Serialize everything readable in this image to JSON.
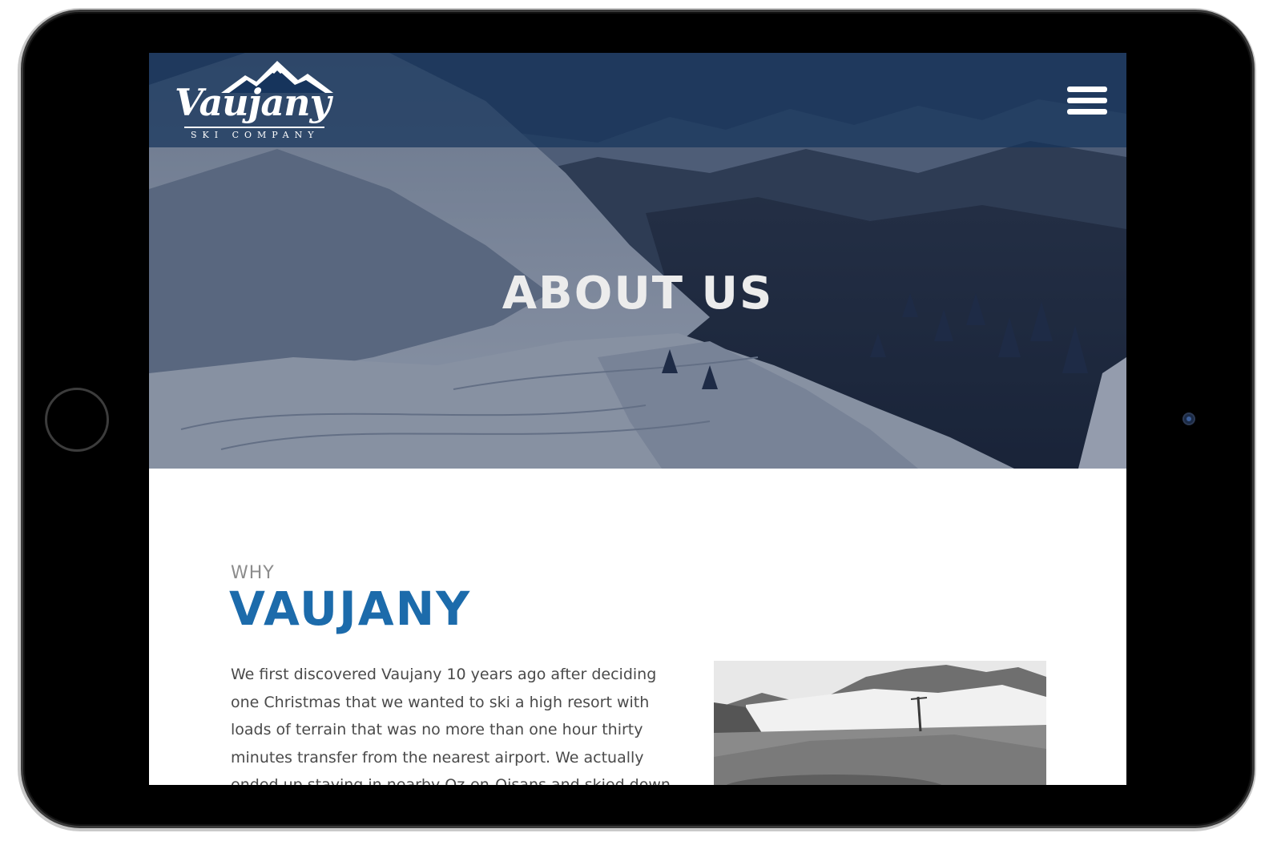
{
  "brand": {
    "name": "Vaujany",
    "tagline": "SKI COMPANY"
  },
  "nav": {
    "menu_icon": "hamburger-menu-icon"
  },
  "hero": {
    "title": "ABOUT US"
  },
  "section": {
    "eyebrow": "WHY",
    "title": "VAUJANY",
    "body": "We first discovered Vaujany 10 years ago after deciding one Christmas that we wanted to ski a high resort with loads of terrain that was no more than one hour thirty minutes transfer from the nearest airport.   We actually ended up staying in nearby Oz-en-Oisans and skied down into Vaujany one snowy"
  },
  "colors": {
    "accent_blue": "#1c6bab",
    "header_overlay": "#16345c",
    "text_gray": "#4a4a4a"
  }
}
